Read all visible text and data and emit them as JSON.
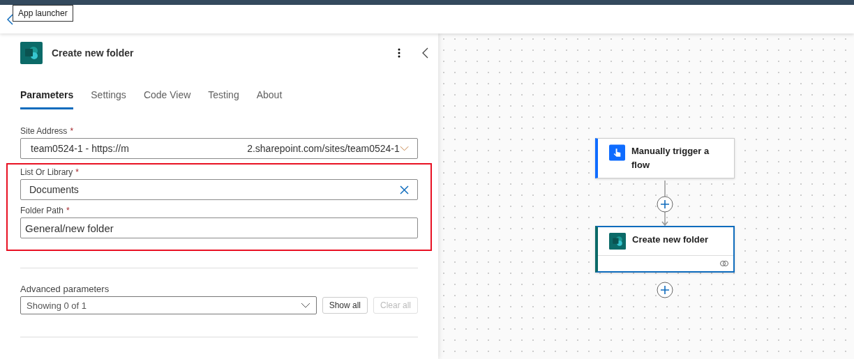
{
  "header": {
    "tooltip": "App launcher"
  },
  "panel": {
    "title": "Create new folder",
    "tabs": [
      {
        "label": "Parameters",
        "selected": true
      },
      {
        "label": "Settings",
        "selected": false
      },
      {
        "label": "Code View",
        "selected": false
      },
      {
        "label": "Testing",
        "selected": false
      },
      {
        "label": "About",
        "selected": false
      }
    ],
    "fields": [
      {
        "kind": "dropdown",
        "label": "Site Address",
        "required_mark": "*",
        "highlighted": false,
        "value_start": "team0524-1 - https://m",
        "value_end": "2.sharepoint.com/sites/team0524-1"
      },
      {
        "kind": "clearable",
        "label": "List Or Library",
        "required_mark": "*",
        "highlighted": true,
        "value": "Documents"
      },
      {
        "kind": "text",
        "label": "Folder Path",
        "required_mark": "*",
        "highlighted": true,
        "value": "General/new folder"
      }
    ],
    "advanced": {
      "label": "Advanced parameters",
      "value": "Showing 0 of 1",
      "buttons": [
        {
          "label": "Show all",
          "disabled": false
        },
        {
          "label": "Clear all",
          "disabled": true
        }
      ]
    }
  },
  "canvas": {
    "nodes": [
      {
        "kind": "trigger",
        "title": "Manually trigger a flow",
        "selected": false
      },
      {
        "kind": "sharepoint",
        "title": "Create new folder",
        "selected": true
      }
    ]
  }
}
